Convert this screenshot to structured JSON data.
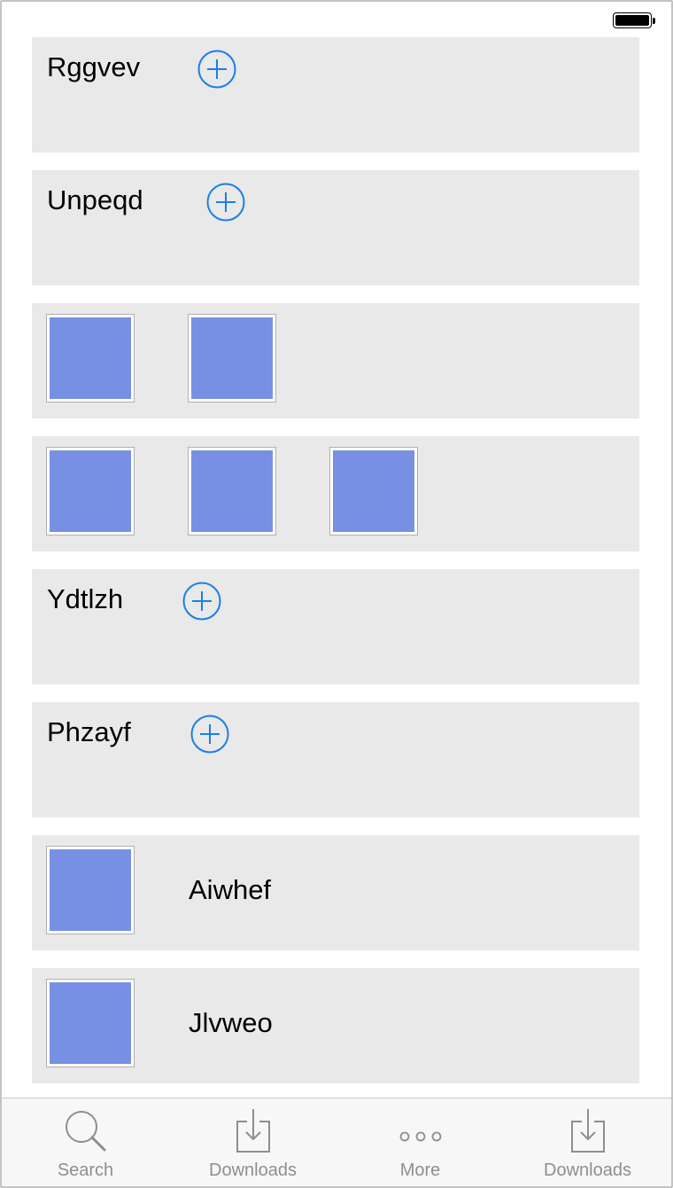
{
  "tabbar": {
    "tabs": [
      {
        "label": "Search",
        "icon": "search-icon"
      },
      {
        "label": "Downloads",
        "icon": "download-icon"
      },
      {
        "label": "More",
        "icon": "more-icon"
      },
      {
        "label": "Downloads",
        "icon": "download-icon"
      }
    ]
  },
  "rows": [
    {
      "type": "title-add",
      "title": "Rggvev"
    },
    {
      "type": "title-add",
      "title": "Unpeqd"
    },
    {
      "type": "thumbnails",
      "count": 2
    },
    {
      "type": "thumbnails",
      "count": 3
    },
    {
      "type": "title-add",
      "title": "Ydtlzh"
    },
    {
      "type": "title-add",
      "title": "Phzayf"
    },
    {
      "type": "thumb-label",
      "label": "Aiwhef"
    },
    {
      "type": "thumb-label",
      "label": "Jlvweo"
    }
  ],
  "colors": {
    "accent": "#1a7fe8",
    "row_background": "#e9e9e9",
    "thumbnail_fill": "#7890e4",
    "tab_inactive": "#8e8e8e"
  }
}
